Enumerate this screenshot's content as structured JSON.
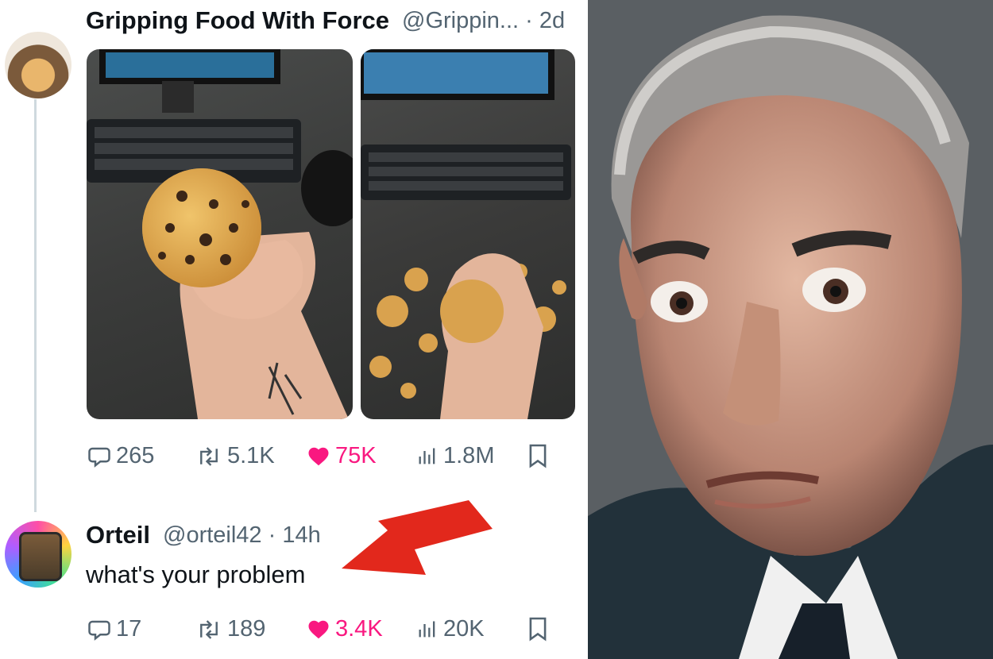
{
  "tweets": [
    {
      "author": "Gripping Food With Force",
      "handle_time": "@Grippin... · 2d",
      "stats": {
        "replies": "265",
        "reposts": "5.1K",
        "likes": "75K",
        "views": "1.8M"
      }
    },
    {
      "author": "Orteil",
      "handle_time": "@orteil42 · 14h",
      "text": "what's your problem",
      "stats": {
        "replies": "17",
        "reposts": "189",
        "likes": "3.4K",
        "views": "20K"
      }
    }
  ],
  "colors": {
    "like_pink": "#f91880",
    "arrow_red": "#e2281c",
    "muted": "#536471"
  },
  "icons": [
    "reply-icon",
    "repost-icon",
    "heart-icon",
    "views-icon",
    "bookmark-icon",
    "arrow-annotation"
  ]
}
